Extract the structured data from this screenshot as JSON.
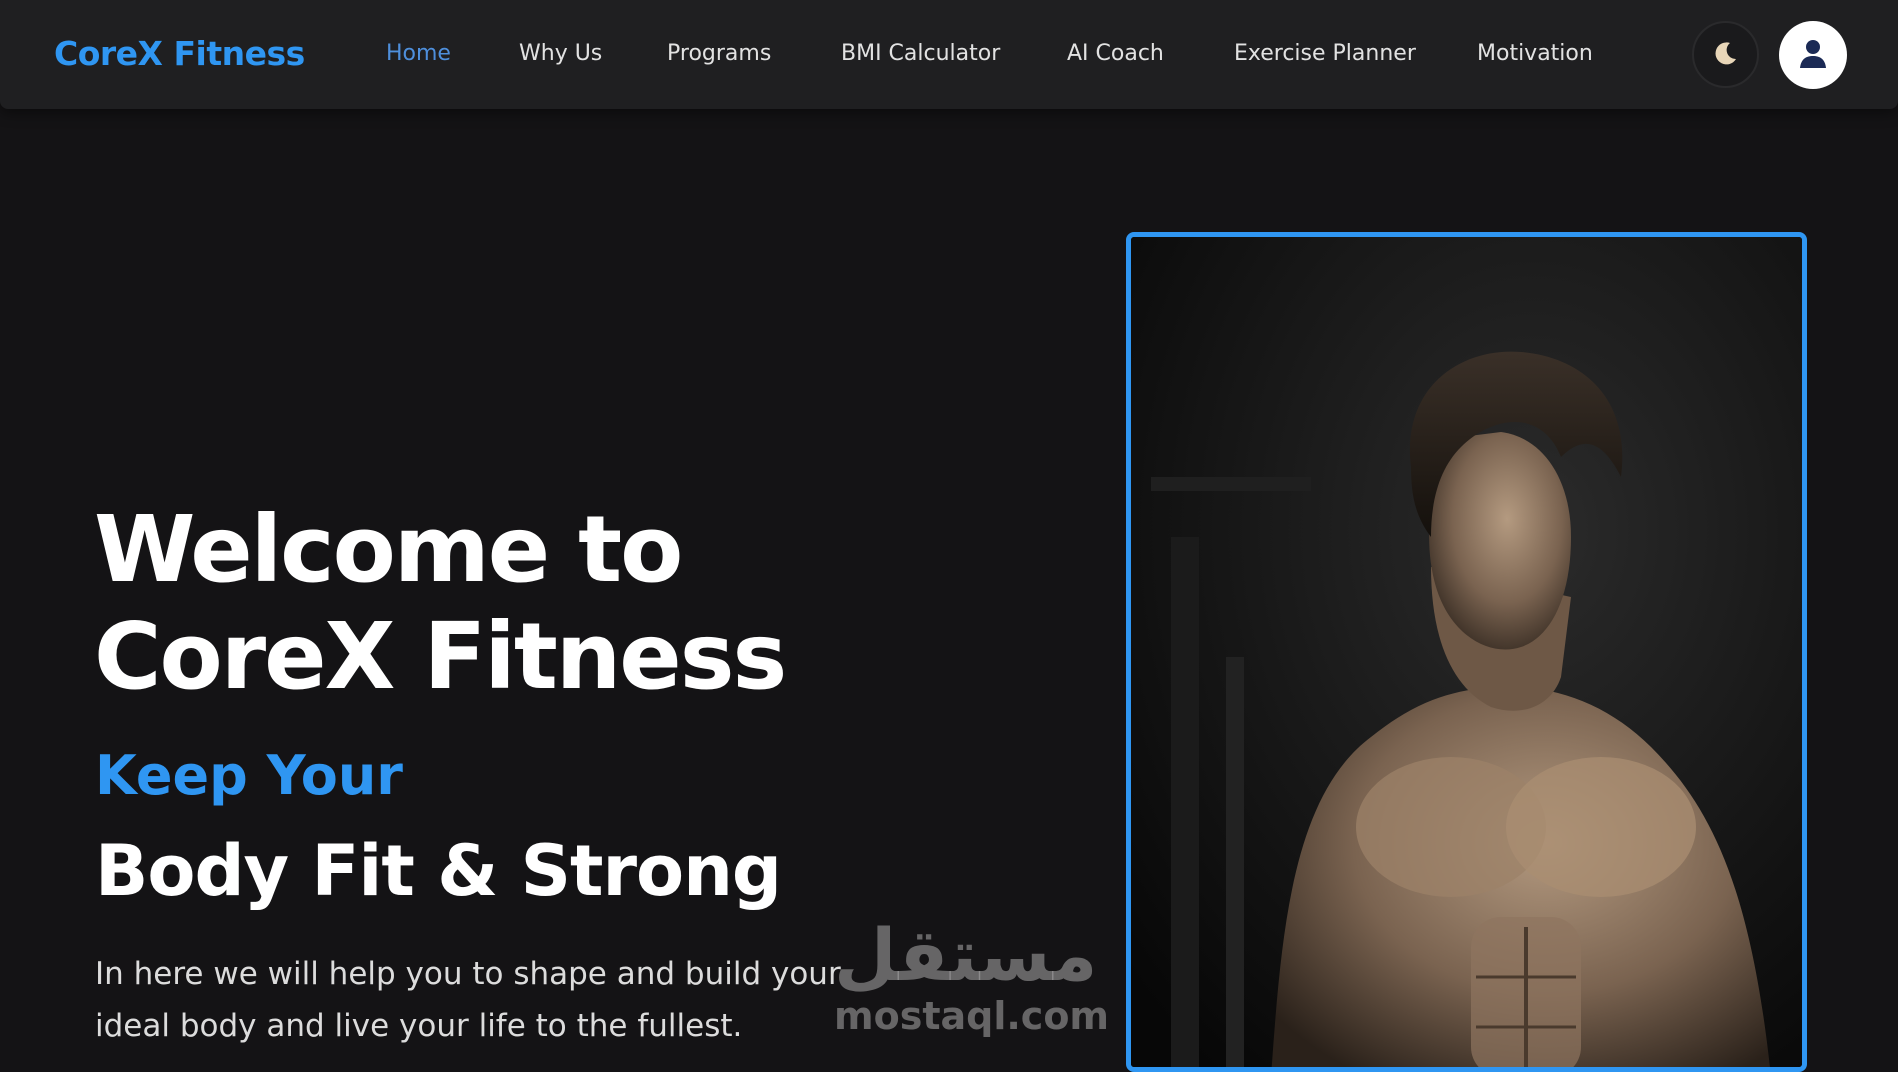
{
  "header": {
    "brand": "CoreX Fitness",
    "nav": [
      {
        "label": "Home",
        "active": true
      },
      {
        "label": "Why Us"
      },
      {
        "label": "Programs"
      },
      {
        "label": "BMI Calculator"
      },
      {
        "label": "AI Coach"
      },
      {
        "label": "Exercise Planner"
      },
      {
        "label": "Motivation"
      }
    ],
    "theme_toggle_icon": "moon-icon",
    "profile_icon": "user-icon"
  },
  "hero": {
    "title_line1": "Welcome to",
    "title_line2": "CoreX Fitness",
    "accent": "Keep Your",
    "subtitle": "Body Fit & Strong",
    "description": "In here we will help you to shape and build your ideal body and live your life to the fullest.",
    "image_alt": "Muscular man with shirt off in dark gym"
  },
  "watermark": {
    "arabic": "مستقل",
    "latin": "mostaql.com"
  },
  "colors": {
    "accent": "#2f96f2",
    "background": "#141315",
    "navbar": "#1f1f21"
  }
}
